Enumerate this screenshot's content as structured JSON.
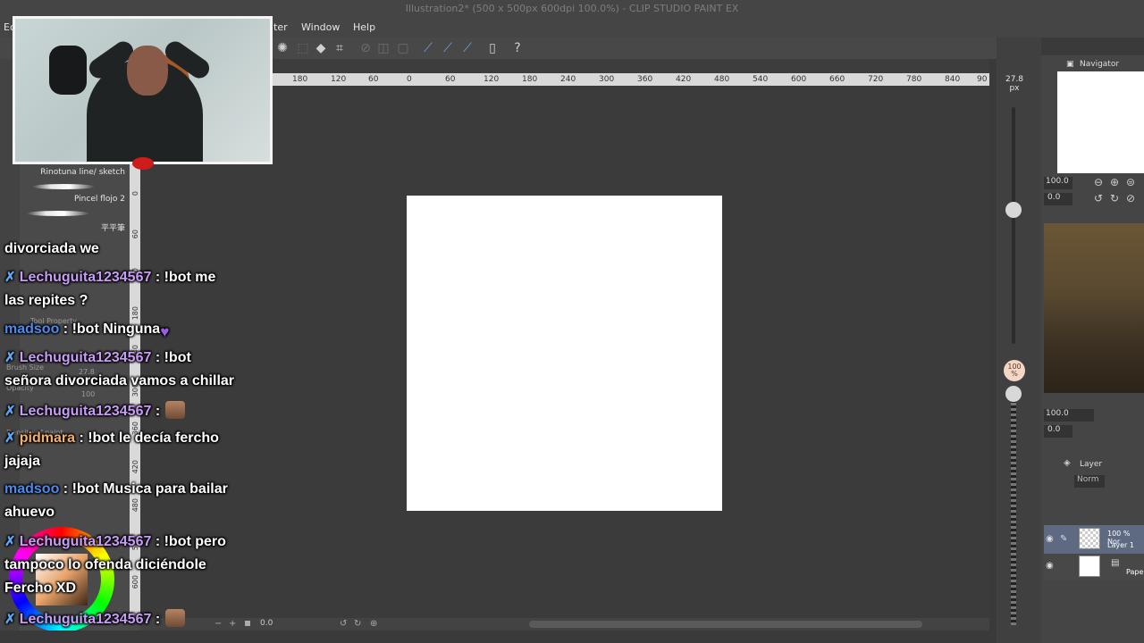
{
  "window": {
    "title": "Illustration2* (500 x 500px 600dpi 100.0%) - CLIP STUDIO PAINT EX"
  },
  "menu": {
    "edit_partial": "Ec",
    "filter_partial": "ter",
    "window": "Window",
    "help": "Help"
  },
  "ruler": {
    "h_ticks": [
      "180",
      "120",
      "60",
      "0",
      "60",
      "120",
      "180",
      "240",
      "300",
      "360",
      "420",
      "480",
      "540",
      "600",
      "660",
      "720",
      "780",
      "840",
      "90"
    ],
    "v_ticks": [
      "0",
      "60",
      "120",
      "180",
      "240",
      "300",
      "360",
      "420",
      "480",
      "540",
      "600"
    ]
  },
  "left_panel": {
    "brushes": [
      {
        "label": "Rinotuna line/ sketch"
      },
      {
        "label": "Pincel flojo 2"
      },
      {
        "label": "平平筆"
      }
    ],
    "tool_property_title": "Tool Property",
    "brush_size_label": "Brush Size",
    "brush_size_value": "27.8",
    "opacity_label": "Opacity",
    "opacity_value": "100",
    "density_label": "Density of paint",
    "color_values": {
      "r": "234",
      "g": "201",
      "b": "180"
    }
  },
  "right_panel": {
    "navigator_title": "Navigator",
    "nav_zoom": "100.0",
    "nav_angle": "0.0",
    "sub_zoom": "100.0",
    "sub_angle": "0.0",
    "layer_title": "Layer",
    "blend_mode": "Norm",
    "layers": [
      {
        "line1": "100 % Nor",
        "line2": "Layer 1"
      },
      {
        "line1": "",
        "line2": "Pape"
      }
    ]
  },
  "size_slider": {
    "value": "27.8",
    "unit": "px"
  },
  "opacity_slider": {
    "value": "100",
    "unit": "%"
  },
  "status": {
    "zoom": "0.0"
  },
  "chat": [
    {
      "name": "",
      "text": "divorciada we",
      "badge": false,
      "name_color": ""
    },
    {
      "name": "Lechuguita1234567",
      "text": " : !bot me",
      "badge": true,
      "name_color": "purple"
    },
    {
      "name": "",
      "text": "las repites ?",
      "badge": false,
      "name_color": ""
    },
    {
      "name": "madsoo",
      "text": " : !bot Ninguna",
      "badge": false,
      "name_color": "blue",
      "emote": "💜"
    },
    {
      "name": "Lechuguita1234567",
      "text": " : !bot",
      "badge": true,
      "name_color": "purple"
    },
    {
      "name": "",
      "text": "señora divorciada vamos a chillar",
      "badge": false,
      "name_color": ""
    },
    {
      "name": "Lechuguita1234567",
      "text": " :",
      "badge": true,
      "name_color": "purple",
      "emote": "cat"
    },
    {
      "name": "pidmara",
      "text": " : !bot le decía fercho",
      "badge": true,
      "name_color": "orange"
    },
    {
      "name": "",
      "text": "jajaja",
      "badge": false,
      "name_color": ""
    },
    {
      "name": "madsoo",
      "text": " : !bot Musica para bailar",
      "badge": false,
      "name_color": "blue"
    },
    {
      "name": "",
      "text": "ahuevo",
      "badge": false,
      "name_color": ""
    },
    {
      "name": "Lechuguita1234567",
      "text": " : !bot pero",
      "badge": true,
      "name_color": "purple"
    },
    {
      "name": "",
      "text": "tampoco lo ofenda diciéndole",
      "badge": false,
      "name_color": ""
    },
    {
      "name": "",
      "text": "Fercho XD",
      "badge": false,
      "name_color": ""
    },
    {
      "name": "Lechuguita1234567",
      "text": " :",
      "badge": true,
      "name_color": "purple",
      "emote": "face"
    }
  ],
  "colors": {
    "accent": "#78a0d8",
    "chat_purple": "#c89cf7",
    "chat_blue": "#4a8cf0",
    "chat_orange": "#f5b06b",
    "badge_blue": "#5ba9f6"
  }
}
